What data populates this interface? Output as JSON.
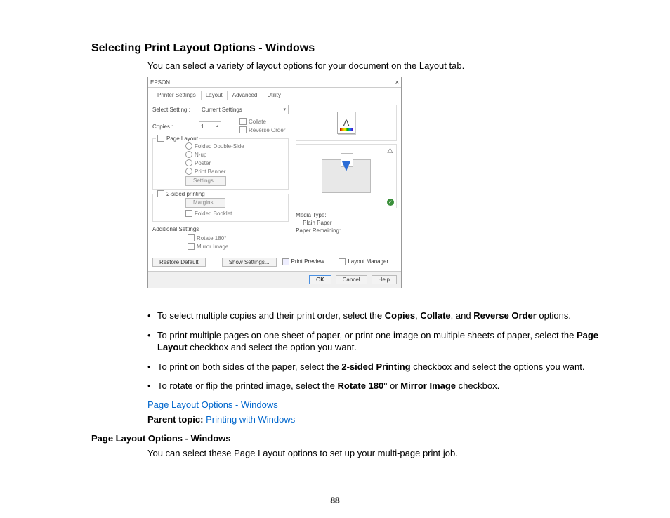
{
  "headings": {
    "main": "Selecting Print Layout Options - Windows",
    "sub": "Page Layout Options - Windows"
  },
  "intro": "You can select a variety of layout options for your document on the Layout tab.",
  "bullets": {
    "b1a": "To select multiple copies and their print order, select the ",
    "b1_copies": "Copies",
    "b1b": ", ",
    "b1_collate": "Collate",
    "b1c": ", and ",
    "b1_reverse": "Reverse Order",
    "b1d": " options.",
    "b2a": "To print multiple pages on one sheet of paper, or print one image on multiple sheets of paper, select the ",
    "b2_pl": "Page Layout",
    "b2b": " checkbox and select the option you want.",
    "b3a": "To print on both sides of the paper, select the ",
    "b3_2s": "2-sided Printing",
    "b3b": " checkbox and select the options you want.",
    "b4a": "To rotate or flip the printed image, select the ",
    "b4_rot": "Rotate 180°",
    "b4b": " or ",
    "b4_mir": "Mirror Image",
    "b4c": " checkbox."
  },
  "links": {
    "page_layout": "Page Layout Options - Windows",
    "parent_label": "Parent topic:",
    "parent_link": "Printing with Windows"
  },
  "sub_intro": "You can select these Page Layout options to set up your multi-page print job.",
  "page_num": "88",
  "dialog": {
    "title": "EPSON",
    "tabs": {
      "t1": "Printer Settings",
      "t2": "Layout",
      "t3": "Advanced",
      "t4": "Utility"
    },
    "labels": {
      "select_setting": "Select Setting :",
      "copies": "Copies :",
      "additional": "Additional Settings"
    },
    "select_value": "Current Settings",
    "copies_val": "1",
    "checks": {
      "collate": "Collate",
      "reverse": "Reverse Order",
      "rotate": "Rotate 180°",
      "mirror": "Mirror Image",
      "print_preview": "Print Preview",
      "layout_mgr": "Layout Manager"
    },
    "page_layout_group": {
      "legend": "Page Layout",
      "r1": "Folded Double-Side",
      "r2": "N-up",
      "r3": "Poster",
      "r4": "Print Banner",
      "settings_btn": "Settings..."
    },
    "twosided_group": {
      "legend": "2-sided printing",
      "margins_btn": "Margins...",
      "folded": "Folded Booklet"
    },
    "right": {
      "thumb_letter": "A",
      "media_type_lbl": "Media Type:",
      "media_type_val": "Plain Paper",
      "paper_rem_lbl": "Paper Remaining:"
    },
    "bottom": {
      "restore": "Restore Default",
      "show": "Show Settings..."
    },
    "footer": {
      "ok": "OK",
      "cancel": "Cancel",
      "help": "Help"
    }
  }
}
